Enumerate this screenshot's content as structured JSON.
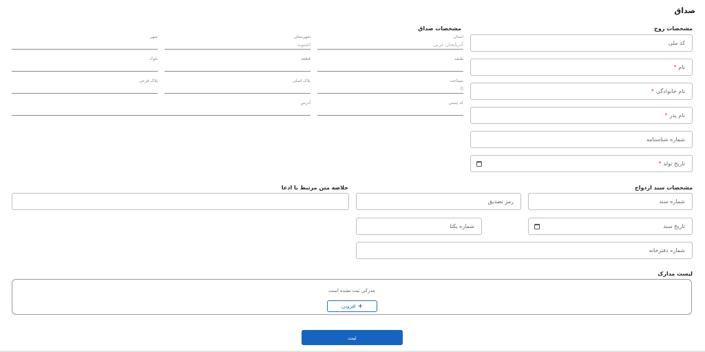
{
  "page_title": "صداق",
  "husband": {
    "title": "مشخصات زوج",
    "national_code": "کد ملی",
    "first_name": "نام",
    "last_name": "نام خانوادگی",
    "father_name": "نام پدر",
    "id_number": "شماره شناسنامه",
    "birth_date": "تاریخ تولد",
    "required_mark": "*"
  },
  "dowry": {
    "title": "مشخصات صداق",
    "province": {
      "label": "استان",
      "value": "آذربایجان غربی"
    },
    "county": {
      "label": "شهرستان",
      "value": "اشنویه"
    },
    "city": {
      "label": "شهر",
      "value": ""
    },
    "floor": {
      "label": "طبقه",
      "value": ""
    },
    "parcel": {
      "label": "قطعه",
      "value": ""
    },
    "block": {
      "label": "بلوک",
      "value": ""
    },
    "area": {
      "label": "مساحت",
      "value": "0"
    },
    "main_plaque": {
      "label": "پلاک اصلی",
      "value": ""
    },
    "sub_plaque": {
      "label": "پلاک فرعی",
      "value": ""
    },
    "postal_code": {
      "label": "کد پستی",
      "value": ""
    },
    "address": {
      "label": "آدرس",
      "value": ""
    }
  },
  "marriage_doc": {
    "title": "مشخصات سند ازدواج",
    "doc_number": "شماره سند",
    "verify_code": "رمز تصدیق",
    "doc_date": "تاریخ سند",
    "unique_number": "شماره یکتا",
    "office_number": "شماره دفترخانه"
  },
  "summary": {
    "title": "خلاصه متن مرتبط با ادعا"
  },
  "documents": {
    "title": "لیست مدارک",
    "empty_text": "مدرکی ثبت نشده است",
    "add_label": "افزودن"
  },
  "submit_label": "ثبت"
}
